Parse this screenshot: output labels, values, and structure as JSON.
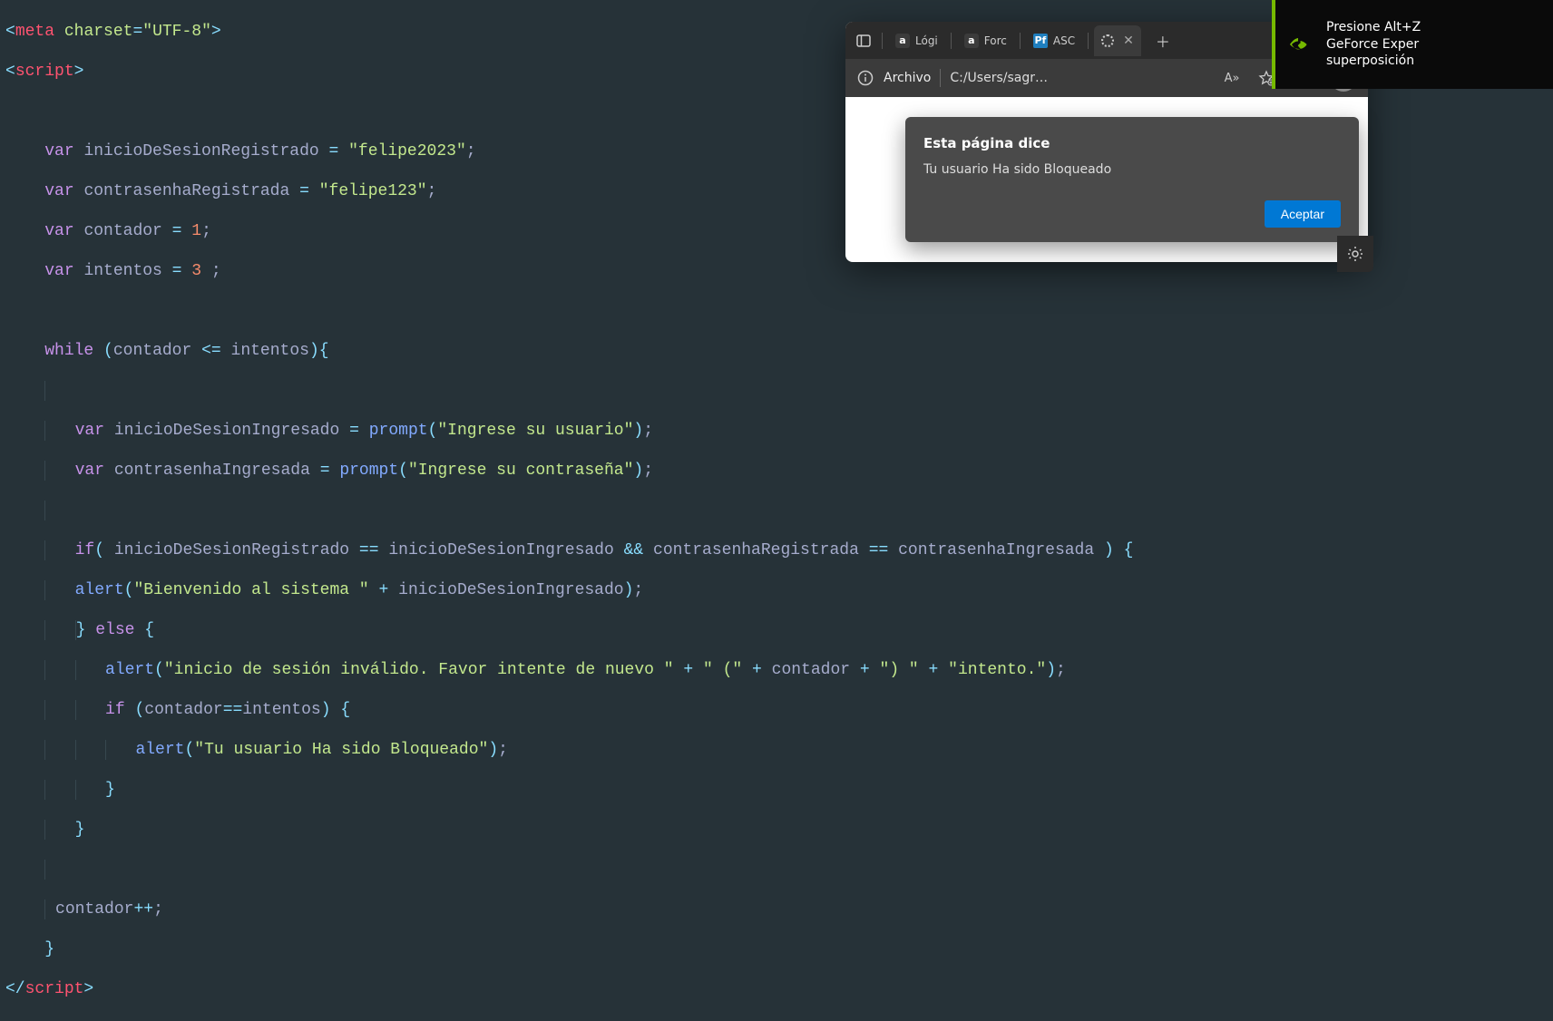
{
  "code": {
    "meta_tag": "meta",
    "meta_attr_name": "charset",
    "meta_attr_val": "\"UTF-8\"",
    "script_tag": "script",
    "kw_var": "var",
    "kw_while": "while",
    "kw_if": "if",
    "kw_else": "else",
    "v_inicioReg": "inicioDeSesionRegistrado",
    "v_contraReg": "contrasenhaRegistrada",
    "v_contador": "contador",
    "v_intentos": "intentos",
    "v_inicioIng": "inicioDeSesionIngresado",
    "v_contraIng": "contrasenhaIngresada",
    "str_felipe2023": "\"felipe2023\"",
    "str_felipe123": "\"felipe123\"",
    "num_1": "1",
    "num_3": "3",
    "fn_prompt": "prompt",
    "fn_alert": "alert",
    "str_ingreseUsuario": "\"Ingrese su usuario\"",
    "str_ingreseContra": "\"Ingrese su contraseña\"",
    "str_bienvenido": "\"Bienvenido al sistema \"",
    "str_invalido": "\"inicio de sesión inválido. Favor intente de nuevo \"",
    "str_openparen": "\" (\"",
    "str_closeparen": "\") \"",
    "str_intento": "\"intento.\"",
    "str_bloqueado": "\"Tu usuario Ha sido Bloqueado\"",
    "op_assign": "=",
    "op_lte": "<=",
    "op_eqeq": "==",
    "op_andand": "&&",
    "op_plus": "+",
    "op_inc": "++",
    "sc": ";"
  },
  "browser": {
    "tabs": [
      {
        "favicon": "a",
        "title": "Lógi"
      },
      {
        "favicon": "a",
        "title": "Forc"
      },
      {
        "favicon": "Pf",
        "title": "ASC"
      },
      {
        "favicon": "loading",
        "title": ""
      }
    ],
    "addr_label": "Archivo",
    "addr_path": "C:/Users/sagr…",
    "read_aloud": "A»"
  },
  "dialog": {
    "title": "Esta página dice",
    "message": "Tu usuario Ha sido Bloqueado",
    "accept": "Aceptar"
  },
  "nvidia": {
    "line1": "Presione Alt+Z",
    "line2": "GeForce Exper",
    "line3": "superposición"
  }
}
